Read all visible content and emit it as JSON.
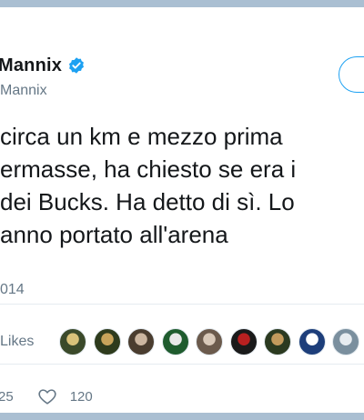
{
  "tweet": {
    "display_name": "Mannix",
    "handle": "Mannix",
    "text_lines": [
      "circa un km e mezzo prima",
      "ermasse, ha chiesto se era i",
      "dei Bucks. Ha detto di sì. Lo",
      "anno portato all'arena"
    ],
    "date": "014",
    "likes_label": "Likes",
    "reply_count": "25",
    "like_count": "120"
  },
  "colors": {
    "verified_badge": "#1da1f2",
    "follow_outline": "#1da1f2",
    "secondary_text": "#657786",
    "background": "#aabfd2"
  },
  "avatars": [
    {
      "name": "avatar-1",
      "colors": [
        "#3b4a2a",
        "#d9c27a"
      ]
    },
    {
      "name": "avatar-2",
      "colors": [
        "#2e3b1c",
        "#c7a35a"
      ]
    },
    {
      "name": "avatar-3",
      "colors": [
        "#4a3d2f",
        "#cbb6a0"
      ]
    },
    {
      "name": "avatar-4",
      "colors": [
        "#1f5c2e",
        "#e8e8e8"
      ]
    },
    {
      "name": "avatar-5",
      "colors": [
        "#6b5a4c",
        "#d8c8b8"
      ]
    },
    {
      "name": "avatar-6",
      "colors": [
        "#1a1a1a",
        "#b82020"
      ]
    },
    {
      "name": "avatar-7",
      "colors": [
        "#2b3a20",
        "#c29a5c"
      ]
    },
    {
      "name": "avatar-8",
      "colors": [
        "#1d3e7a",
        "#ffffff"
      ]
    },
    {
      "name": "avatar-9",
      "colors": [
        "#7a8f9e",
        "#e7ecf0"
      ]
    }
  ]
}
